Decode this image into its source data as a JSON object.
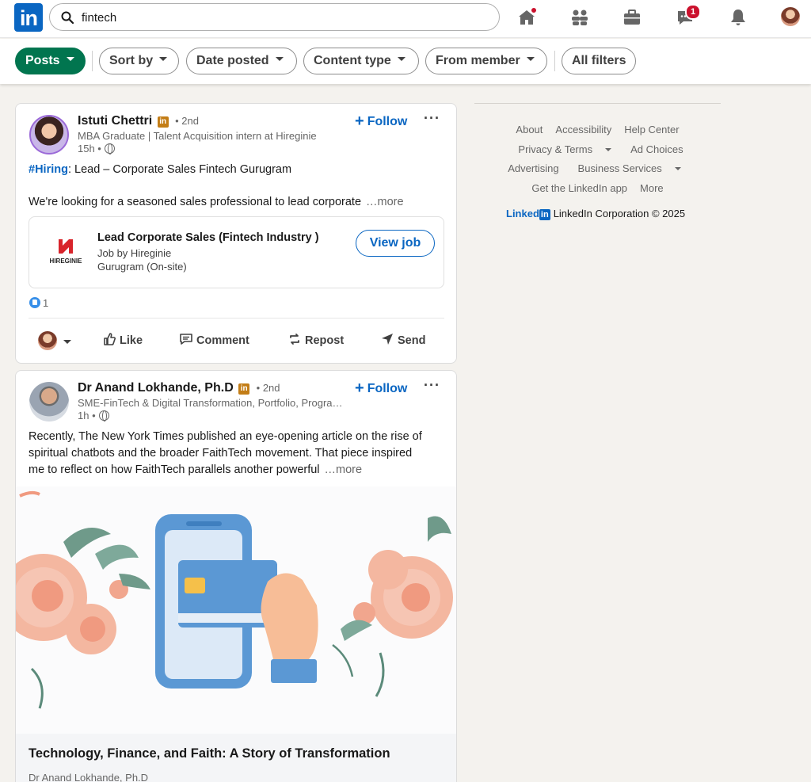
{
  "nav": {
    "logo_text": "in",
    "search_value": "fintech",
    "messaging_badge": "1"
  },
  "filters": {
    "posts": "Posts",
    "sort_by": "Sort by",
    "date_posted": "Date posted",
    "content_type": "Content type",
    "from_member": "From member",
    "all_filters": "All filters"
  },
  "post1": {
    "author": "Istuti Chettri",
    "in_badge": "in",
    "degree": "• 2nd",
    "headline": "MBA Graduate | Talent Acquisition intern at Hireginie",
    "time": "15h •",
    "follow": "Follow",
    "hashtag": "#Hiring",
    "line1_rest": ": Lead – Corporate Sales Fintech Gurugram",
    "line2": "We're looking for a seasoned sales professional to lead corporate",
    "more": "…more",
    "job": {
      "logo_text": "HIREGINIE",
      "title": "Lead Corporate Sales (Fintech Industry )",
      "company": "Job by Hireginie",
      "location": "Gurugram (On-site)",
      "button": "View job"
    },
    "reaction_count": "1",
    "actions": {
      "like": "Like",
      "comment": "Comment",
      "repost": "Repost",
      "send": "Send"
    }
  },
  "post2": {
    "author": "Dr Anand Lokhande, Ph.D",
    "in_badge": "in",
    "degree": "• 2nd",
    "headline": "SME-FinTech & Digital Transformation, Portfolio, Progra…",
    "time": "1h •",
    "follow": "Follow",
    "text_line1": "Recently, The New York Times published an eye-opening article on the rise of",
    "text_line2": "spiritual chatbots and the broader FaithTech movement. That piece inspired",
    "text_line3": "me to reflect on how FaithTech parallels another powerful",
    "more": "…more",
    "article_title": "Technology, Finance, and Faith: A Story of Transformation",
    "article_author": "Dr Anand Lokhande, Ph.D"
  },
  "footer": {
    "about": "About",
    "accessibility": "Accessibility",
    "help_center": "Help Center",
    "privacy_terms": "Privacy & Terms",
    "ad_choices": "Ad Choices",
    "advertising": "Advertising",
    "business_services": "Business Services",
    "get_app": "Get the LinkedIn app",
    "more": "More",
    "brand_word": "Linked",
    "brand_box": "in",
    "copyright": "LinkedIn Corporation © 2025"
  },
  "colors": {
    "brand": "#0a66c2",
    "active_filter": "#01754f",
    "notification": "#cb112d"
  }
}
